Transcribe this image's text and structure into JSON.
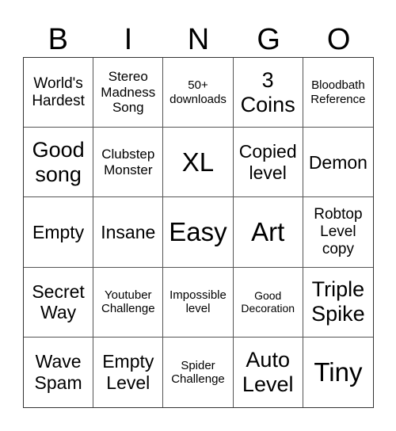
{
  "header": {
    "letters": [
      "B",
      "I",
      "N",
      "G",
      "O"
    ]
  },
  "cells": [
    "World's Hardest",
    "Stereo Madness Song",
    "50+ downloads",
    "3 Coins",
    "Bloodbath Reference",
    "Good song",
    "Clubstep Monster",
    "XL",
    "Copied level",
    "Demon",
    "Empty",
    "Insane",
    "Easy",
    "Art",
    "Robtop Level copy",
    "Secret Way",
    "Youtuber Challenge",
    "Impossible level",
    "Good Decoration",
    "Triple Spike",
    "Wave Spam",
    "Empty Level",
    "Spider Challenge",
    "Auto Level",
    "Tiny"
  ]
}
